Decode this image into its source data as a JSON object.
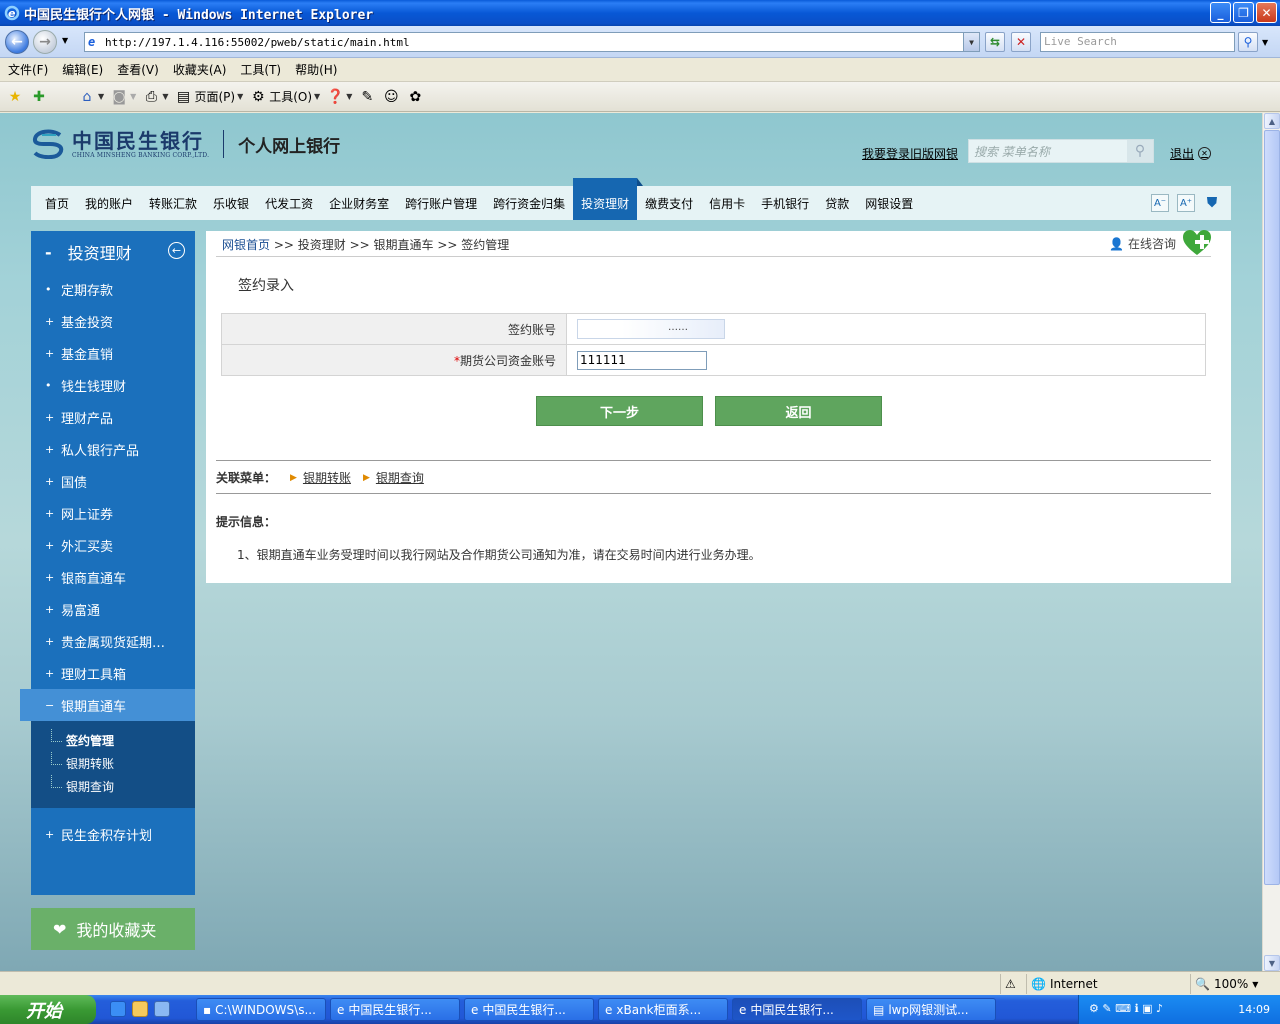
{
  "window": {
    "title": "中国民生银行个人网银 - Windows Internet Explorer",
    "address": "http://197.1.4.116:55002/pweb/static/main.html",
    "live_search_placeholder": "Live Search"
  },
  "ie_menu": [
    "文件(F)",
    "编辑(E)",
    "查看(V)",
    "收藏夹(A)",
    "工具(T)",
    "帮助(H)"
  ],
  "ie_toolbar": {
    "page_label": "页面(P)",
    "tools_label": "工具(O)"
  },
  "bank_header": {
    "logo_cn": "中国民生银行",
    "logo_en": "CHINA MINSHENG BANKING CORP.,LTD.",
    "product": "个人网上银行",
    "old_version_link": "我要登录旧版网银",
    "search_placeholder": "搜索 菜单名称",
    "logout": "退出"
  },
  "main_nav": {
    "items": [
      "首页",
      "我的账户",
      "转账汇款",
      "乐收银",
      "代发工资",
      "企业财务室",
      "跨行账户管理",
      "跨行资金归集",
      "投资理财",
      "缴费支付",
      "信用卡",
      "手机银行",
      "贷款",
      "网银设置"
    ],
    "active": "投资理财"
  },
  "sidebar": {
    "header": "投资理财",
    "items": [
      {
        "prefix": "•",
        "label": "定期存款"
      },
      {
        "prefix": "+",
        "label": "基金投资"
      },
      {
        "prefix": "+",
        "label": "基金直销"
      },
      {
        "prefix": "•",
        "label": "钱生钱理财"
      },
      {
        "prefix": "+",
        "label": "理财产品"
      },
      {
        "prefix": "+",
        "label": "私人银行产品"
      },
      {
        "prefix": "+",
        "label": "国债"
      },
      {
        "prefix": "+",
        "label": "网上证券"
      },
      {
        "prefix": "+",
        "label": "外汇买卖"
      },
      {
        "prefix": "+",
        "label": "银商直通车"
      },
      {
        "prefix": "+",
        "label": "易富通"
      },
      {
        "prefix": "+",
        "label": "贵金属现货延期…"
      },
      {
        "prefix": "+",
        "label": "理财工具箱"
      }
    ],
    "expanded": {
      "prefix": "−",
      "label": "银期直通车"
    },
    "sub_items": [
      "签约管理",
      "银期转账",
      "银期查询"
    ],
    "last_item": {
      "prefix": "+",
      "label": "民生金积存计划"
    },
    "favorites": "我的收藏夹"
  },
  "content": {
    "breadcrumb_home": "网银首页",
    "breadcrumb_rest": ">> 投资理财 >> 银期直通车 >> 签约管理",
    "consult": "在线咨询",
    "section_title": "签约录入",
    "fields": {
      "account_label": "签约账号",
      "account_masked": "……",
      "futures_label": "期货公司资金账号",
      "futures_value": "111111"
    },
    "buttons": {
      "next": "下一步",
      "back": "返回"
    },
    "related_label": "关联菜单：",
    "related_links": [
      "银期转账",
      "银期查询"
    ],
    "hint_label": "提示信息：",
    "hint_text": "1、银期直通车业务受理时间以我行网站及合作期货公司通知为准，请在交易时间内进行业务办理。"
  },
  "statusbar": {
    "zone": "Internet",
    "zoom": "100%"
  },
  "taskbar": {
    "start": "开始",
    "tasks": [
      "C:\\WINDOWS\\s...",
      "中国民生银行...",
      "中国民生银行...",
      "xBank柜面系...",
      "中国民生银行...",
      "lwp网银测试..."
    ],
    "clock": "14:09"
  }
}
